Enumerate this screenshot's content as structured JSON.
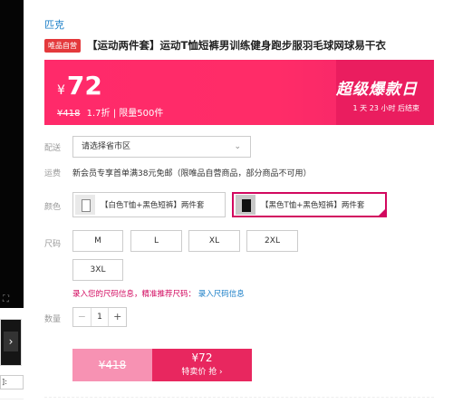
{
  "gallery": {
    "fullscreen_icon": "fullscreen-icon",
    "next_arrow": "›",
    "select_value": "]:"
  },
  "header": {
    "shop_name": "匹克",
    "badge": "唯品自营",
    "title": "【运动两件套】运动T恤短裤男训练健身跑步服羽毛球网球易干衣"
  },
  "banner": {
    "currency": "¥",
    "price": "72",
    "original_price": "¥418",
    "discount": "1.7折",
    "limit": "| 限量500件",
    "promo_title": "超级爆款日",
    "countdown": "1 天 23 小时 后结束"
  },
  "delivery": {
    "label": "配送",
    "placeholder": "请选择省市区",
    "chevron_icon": "chevron-down-icon"
  },
  "shipping": {
    "label": "运费",
    "text": "新会员专享首单满38元免邮（限唯品自营商品，部分商品不可用）"
  },
  "color": {
    "label": "颜色",
    "options": [
      {
        "label": "【白色T恤+黑色短裤】两件套",
        "selected": false
      },
      {
        "label": "【黑色T恤+黑色短裤】两件套",
        "selected": true
      }
    ]
  },
  "size": {
    "label": "尺码",
    "options": [
      "M",
      "L",
      "XL",
      "2XL",
      "3XL"
    ],
    "link_text": "录入您的尺码信息，精准推荐尺码：",
    "link_action": "录入尺码信息"
  },
  "quantity": {
    "label": "数量",
    "minus": "−",
    "value": "1",
    "plus": "+"
  },
  "buy_button": {
    "original_price": "¥418",
    "price": "¥72",
    "label": "特卖价 抢 ›"
  },
  "colors": {
    "accent": "#ff2a6a",
    "brand_red": "#e4393c",
    "link_blue": "#1a7ec7",
    "selected_border": "#d2085f"
  }
}
